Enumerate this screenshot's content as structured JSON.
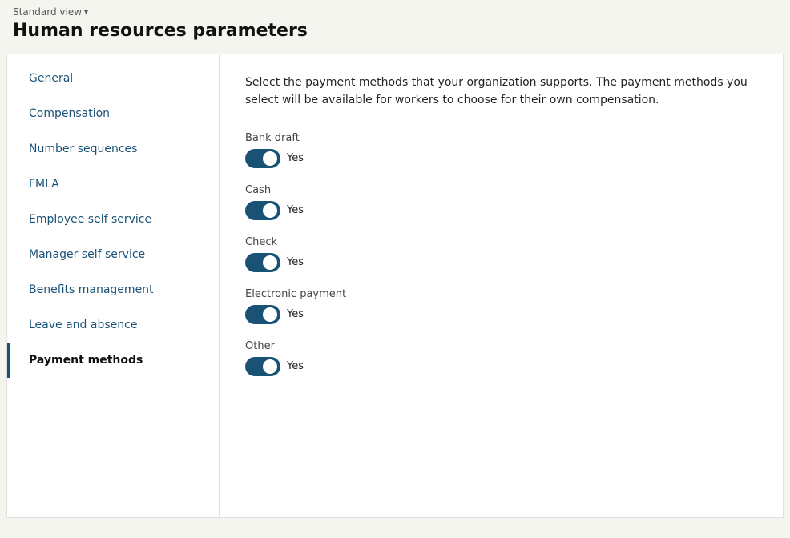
{
  "top": {
    "standard_view_label": "Standard view",
    "chevron": "▾"
  },
  "page": {
    "title": "Human resources parameters"
  },
  "sidebar": {
    "items": [
      {
        "id": "general",
        "label": "General",
        "active": false
      },
      {
        "id": "compensation",
        "label": "Compensation",
        "active": false
      },
      {
        "id": "number-sequences",
        "label": "Number sequences",
        "active": false
      },
      {
        "id": "fmla",
        "label": "FMLA",
        "active": false
      },
      {
        "id": "employee-self-service",
        "label": "Employee self service",
        "active": false
      },
      {
        "id": "manager-self-service",
        "label": "Manager self service",
        "active": false
      },
      {
        "id": "benefits-management",
        "label": "Benefits management",
        "active": false
      },
      {
        "id": "leave-and-absence",
        "label": "Leave and absence",
        "active": false
      },
      {
        "id": "payment-methods",
        "label": "Payment methods",
        "active": true
      }
    ]
  },
  "main": {
    "description": "Select the payment methods that your organization supports. The payment methods you select will be available for workers to choose for their own compensation.",
    "payment_methods": [
      {
        "id": "bank-draft",
        "label": "Bank draft",
        "enabled": true,
        "value_label": "Yes"
      },
      {
        "id": "cash",
        "label": "Cash",
        "enabled": true,
        "value_label": "Yes"
      },
      {
        "id": "check",
        "label": "Check",
        "enabled": true,
        "value_label": "Yes"
      },
      {
        "id": "electronic-payment",
        "label": "Electronic payment",
        "enabled": true,
        "value_label": "Yes"
      },
      {
        "id": "other",
        "label": "Other",
        "enabled": true,
        "value_label": "Yes"
      }
    ]
  }
}
